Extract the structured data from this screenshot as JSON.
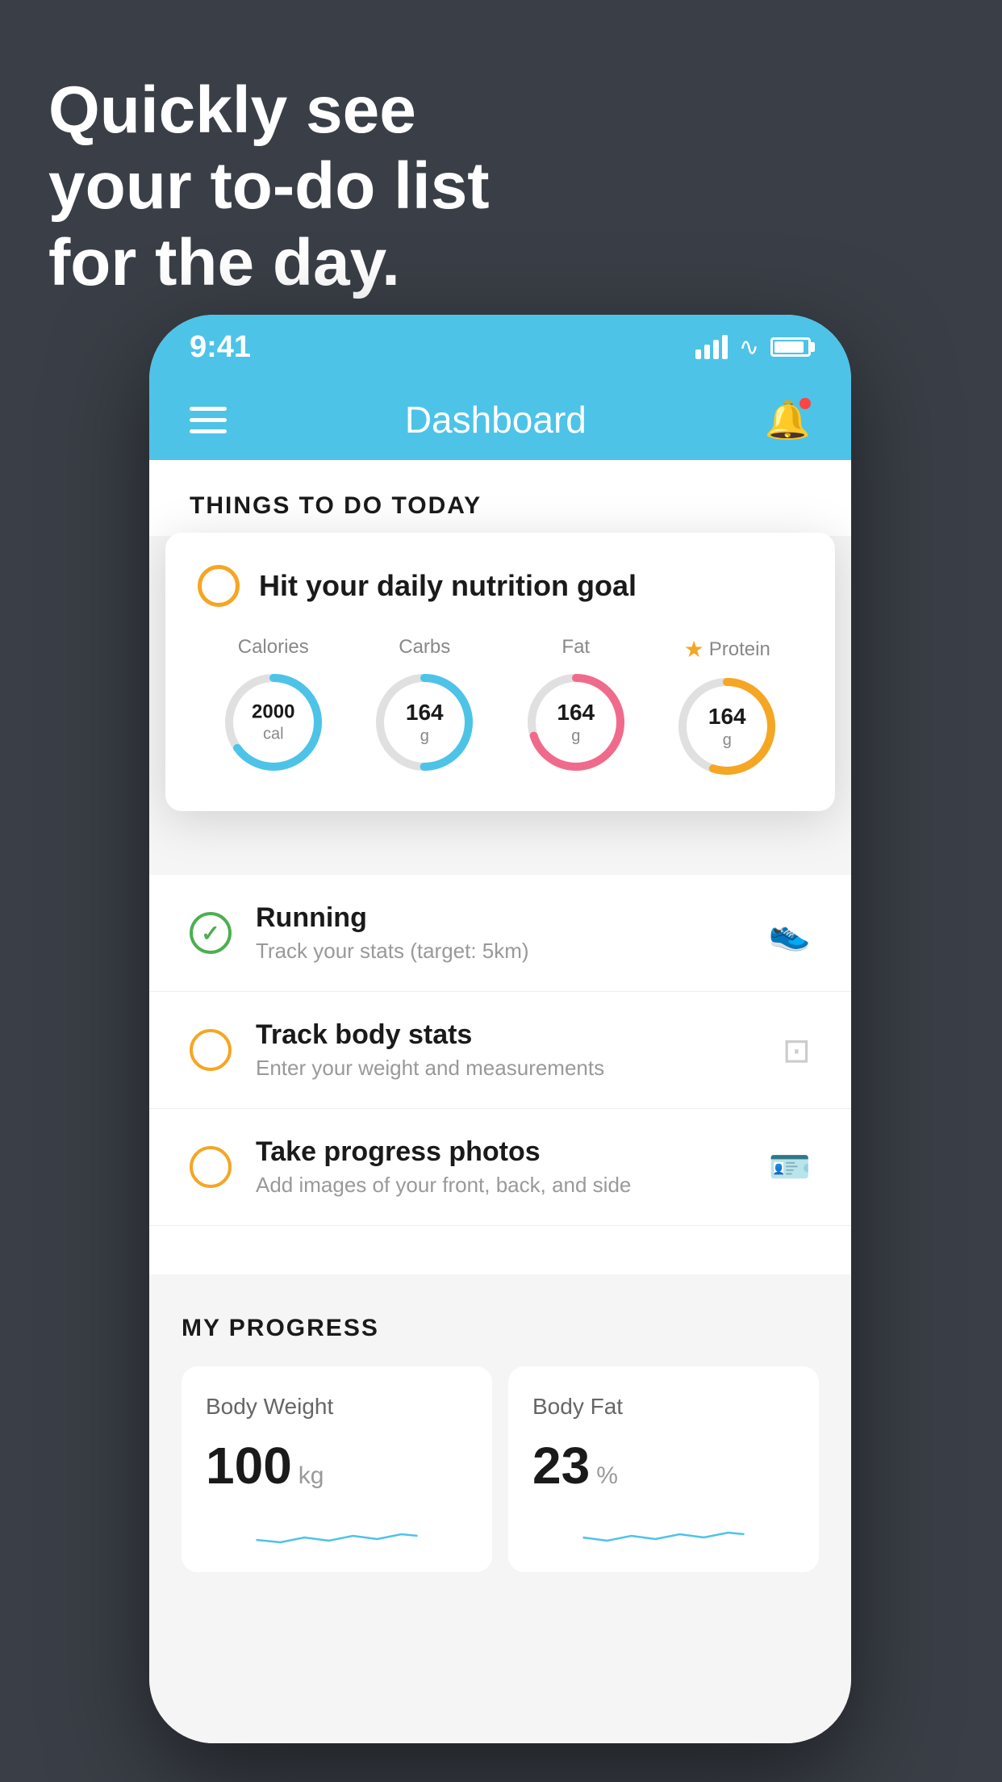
{
  "headline": {
    "line1": "Quickly see",
    "line2": "your to-do list",
    "line3": "for the day."
  },
  "status_bar": {
    "time": "9:41"
  },
  "nav": {
    "title": "Dashboard"
  },
  "things_section": {
    "header": "THINGS TO DO TODAY"
  },
  "nutrition_card": {
    "title": "Hit your daily nutrition goal",
    "items": [
      {
        "label": "Calories",
        "value": "2000",
        "unit": "cal",
        "color": "#4dc3e8",
        "track_color": "#e0e0e0",
        "pct": 65
      },
      {
        "label": "Carbs",
        "value": "164",
        "unit": "g",
        "color": "#4dc3e8",
        "track_color": "#e0e0e0",
        "pct": 50
      },
      {
        "label": "Fat",
        "value": "164",
        "unit": "g",
        "color": "#f06b8b",
        "track_color": "#e0e0e0",
        "pct": 70
      },
      {
        "label": "Protein",
        "value": "164",
        "unit": "g",
        "color": "#f5a623",
        "track_color": "#e0e0e0",
        "pct": 55,
        "star": true
      }
    ]
  },
  "todo_items": [
    {
      "title": "Running",
      "subtitle": "Track your stats (target: 5km)",
      "checked": true,
      "icon": "shoe"
    },
    {
      "title": "Track body stats",
      "subtitle": "Enter your weight and measurements",
      "checked": false,
      "icon": "scale"
    },
    {
      "title": "Take progress photos",
      "subtitle": "Add images of your front, back, and side",
      "checked": false,
      "icon": "person"
    }
  ],
  "progress_section": {
    "header": "MY PROGRESS",
    "cards": [
      {
        "title": "Body Weight",
        "value": "100",
        "unit": "kg"
      },
      {
        "title": "Body Fat",
        "value": "23",
        "unit": "%"
      }
    ]
  }
}
